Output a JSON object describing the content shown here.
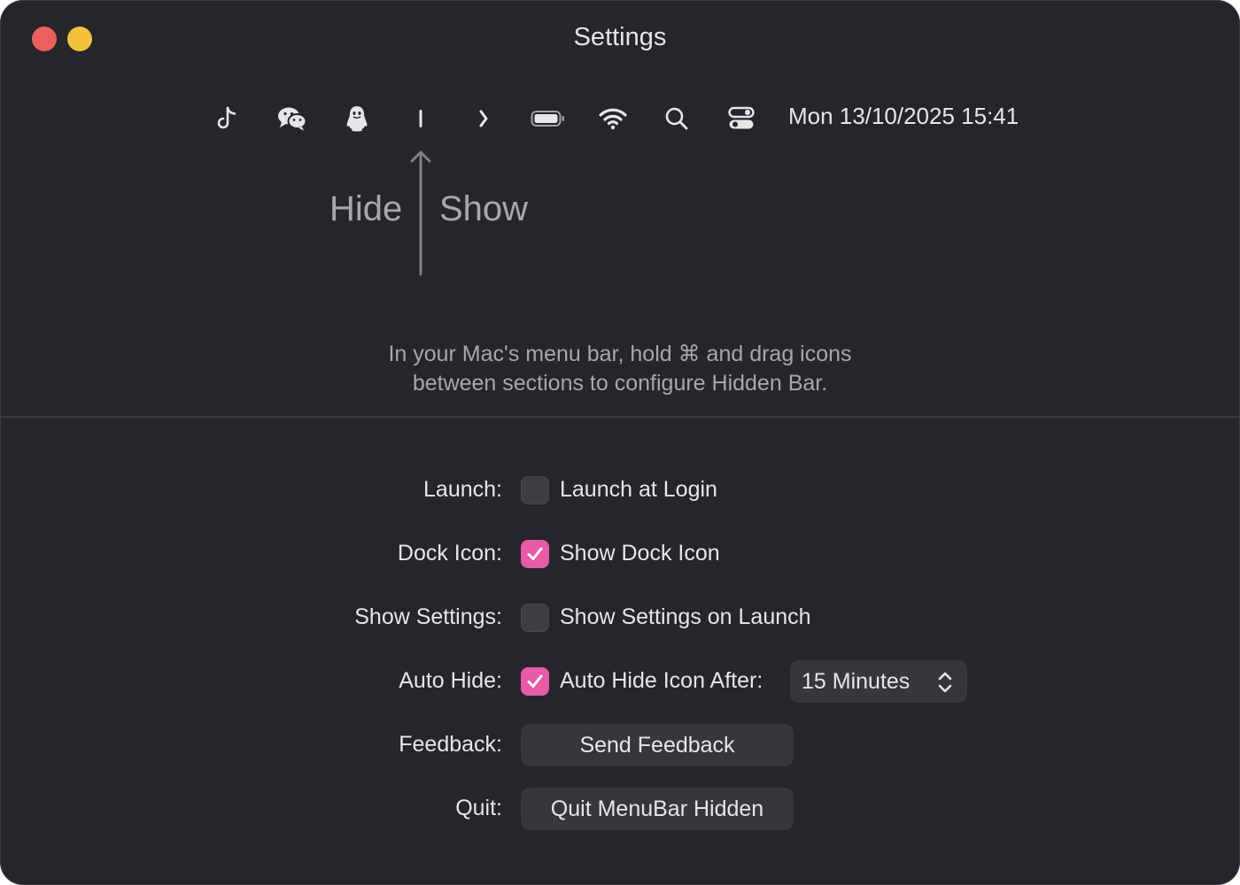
{
  "window": {
    "title": "Settings"
  },
  "menubar_preview": {
    "icons": [
      "tiktok-icon",
      "wechat-icon",
      "qq-penguin-icon",
      "separator-bar-icon",
      "expand-chevron-icon",
      "battery-icon",
      "wifi-icon",
      "search-icon",
      "control-center-icon"
    ],
    "clock": "Mon 13/10/2025 15:41"
  },
  "diagram": {
    "hide_label": "Hide",
    "show_label": "Show"
  },
  "instructions": {
    "line1": "In your Mac's menu bar, hold ⌘ and drag icons",
    "line2": "between sections to configure Hidden Bar."
  },
  "settings": {
    "launch": {
      "label": "Launch:",
      "option": "Launch at Login",
      "checked": false
    },
    "dock_icon": {
      "label": "Dock Icon:",
      "option": "Show Dock Icon",
      "checked": true
    },
    "show_settings": {
      "label": "Show Settings:",
      "option": "Show Settings on Launch",
      "checked": false
    },
    "auto_hide": {
      "label": "Auto Hide:",
      "option": "Auto Hide Icon After:",
      "checked": true,
      "duration": "15 Minutes"
    },
    "feedback": {
      "label": "Feedback:",
      "button": "Send Feedback"
    },
    "quit": {
      "label": "Quit:",
      "button": "Quit MenuBar Hidden"
    }
  },
  "colors": {
    "window_bg": "#25262b",
    "accent": "#e85aa3",
    "close": "#ec5f5d",
    "minimize": "#f2c33a",
    "text": "#e6e6e8",
    "muted_text": "#a6a7aa",
    "control_bg": "#36373c"
  }
}
